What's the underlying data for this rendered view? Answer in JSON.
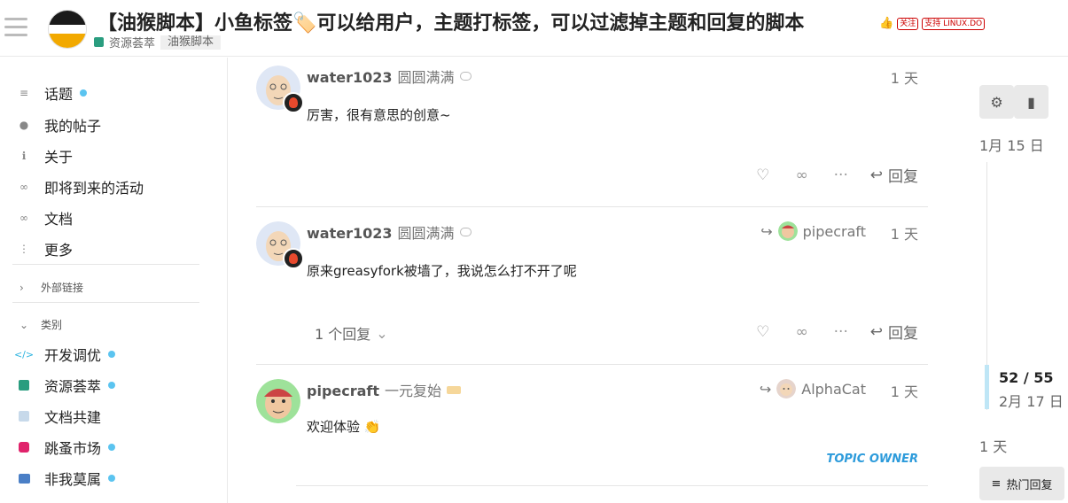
{
  "header": {
    "title": "【油猴脚本】小鱼标签🏷️可以给用户，主题打标签，可以过滤掉主题和回复的脚本",
    "badge_follow": "关注",
    "badge_support": "支持 LINUX.DO",
    "thumb": "👍",
    "category": "资源荟萃",
    "tag": "油猴脚本"
  },
  "sidebar": {
    "items": [
      {
        "label": "话题",
        "icon": "layers-icon",
        "dot": true
      },
      {
        "label": "我的帖子",
        "icon": "user-icon",
        "dot": false
      },
      {
        "label": "关于",
        "icon": "info-icon",
        "dot": false
      },
      {
        "label": "即将到来的活动",
        "icon": "link-icon",
        "dot": false
      },
      {
        "label": "文档",
        "icon": "link-icon",
        "dot": false
      },
      {
        "label": "更多",
        "icon": "more-vertical-icon",
        "dot": false
      }
    ],
    "external_links": "外部链接",
    "categories_heading": "类别",
    "categories": [
      {
        "label": "开发调优",
        "color": "#2fb4e0",
        "dot": true
      },
      {
        "label": "资源荟萃",
        "color": "#2a9d7f",
        "dot": true
      },
      {
        "label": "文档共建",
        "color": "#c7d9ea",
        "dot": false
      },
      {
        "label": "跳蚤市场",
        "color": "#e0236b",
        "dot": true
      },
      {
        "label": "非我莫属",
        "color": "#4a7fc6",
        "dot": true
      }
    ]
  },
  "posts": [
    {
      "username": "water1023",
      "user_title": "圆圆满满",
      "date": "1 天",
      "body": "厉害，很有意思的创意~",
      "reply_label": "回复"
    },
    {
      "username": "water1023",
      "user_title": "圆圆满满",
      "reply_to": "pipecraft",
      "date": "1 天",
      "body": "原来greasyfork被墙了，我说怎么打不开了呢",
      "replies_count": "1 个回复",
      "reply_label": "回复"
    },
    {
      "username": "pipecraft",
      "user_title": "一元复始",
      "reply_to": "AlphaCat",
      "date": "1 天",
      "body": "欢迎体验 👏",
      "owner_label": "TOPIC OWNER"
    }
  ],
  "timeline": {
    "start_date": "1月 15 日",
    "position": "52 / 55",
    "current_date": "2月 17 日",
    "end_date": "1 天",
    "hot_label": "热门回复"
  }
}
